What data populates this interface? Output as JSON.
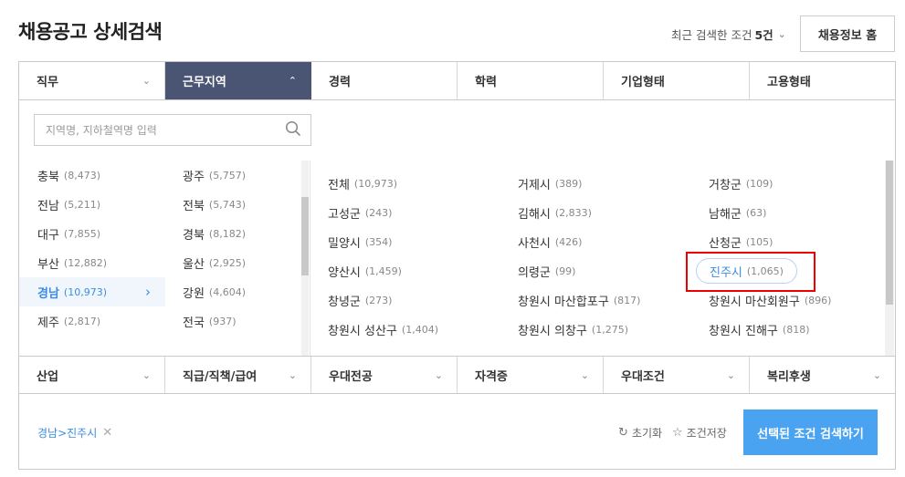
{
  "header": {
    "title": "채용공고 상세검색",
    "recent_prefix": "최근 검색한 조건 ",
    "recent_count": "5건",
    "home_button": "채용정보 홈"
  },
  "top_tabs": [
    {
      "label": "직무",
      "icon": "chevron-down-icon"
    },
    {
      "label": "근무지역",
      "icon": "chevron-up-icon",
      "active": true
    },
    {
      "label": "경력"
    },
    {
      "label": "학력"
    },
    {
      "label": "기업형태"
    },
    {
      "label": "고용형태"
    }
  ],
  "search": {
    "placeholder": "지역명, 지하철역명 입력",
    "icon": "search-icon"
  },
  "regions": [
    {
      "name": "충북",
      "count": "(8,473)"
    },
    {
      "name": "광주",
      "count": "(5,757)"
    },
    {
      "name": "전남",
      "count": "(5,211)"
    },
    {
      "name": "전북",
      "count": "(5,743)"
    },
    {
      "name": "대구",
      "count": "(7,855)"
    },
    {
      "name": "경북",
      "count": "(8,182)"
    },
    {
      "name": "부산",
      "count": "(12,882)"
    },
    {
      "name": "울산",
      "count": "(2,925)"
    },
    {
      "name": "경남",
      "count": "(10,973)",
      "selected": true
    },
    {
      "name": "강원",
      "count": "(4,604)"
    },
    {
      "name": "제주",
      "count": "(2,817)"
    },
    {
      "name": "전국",
      "count": "(937)"
    }
  ],
  "subregions": [
    {
      "name": "전체",
      "count": "(10,973)"
    },
    {
      "name": "거제시",
      "count": "(389)"
    },
    {
      "name": "거창군",
      "count": "(109)"
    },
    {
      "name": "고성군",
      "count": "(243)"
    },
    {
      "name": "김해시",
      "count": "(2,833)"
    },
    {
      "name": "남해군",
      "count": "(63)"
    },
    {
      "name": "밀양시",
      "count": "(354)"
    },
    {
      "name": "사천시",
      "count": "(426)"
    },
    {
      "name": "산청군",
      "count": "(105)"
    },
    {
      "name": "양산시",
      "count": "(1,459)"
    },
    {
      "name": "의령군",
      "count": "(99)"
    },
    {
      "name": "진주시",
      "count": "(1,065)",
      "selected": true
    },
    {
      "name": "창녕군",
      "count": "(273)"
    },
    {
      "name": "창원시 마산합포구",
      "count": "(817)"
    },
    {
      "name": "창원시 마산회원구",
      "count": "(896)"
    },
    {
      "name": "창원시 성산구",
      "count": "(1,404)"
    },
    {
      "name": "창원시 의창구",
      "count": "(1,275)"
    },
    {
      "name": "창원시 진해구",
      "count": "(818)"
    }
  ],
  "bottom_tabs": [
    {
      "label": "산업"
    },
    {
      "label": "직급/직책/급여"
    },
    {
      "label": "우대전공"
    },
    {
      "label": "자격증"
    },
    {
      "label": "우대조건"
    },
    {
      "label": "복리후생"
    }
  ],
  "footer": {
    "selected_chip": "경남>진주시",
    "reset_label": "초기화",
    "save_label": "조건저장",
    "submit_label": "선택된 조건 검색하기"
  },
  "colors": {
    "active_tab": "#4a5473",
    "accent": "#3a8de0",
    "submit": "#4aa3f1",
    "highlight_box": "#e00000"
  }
}
